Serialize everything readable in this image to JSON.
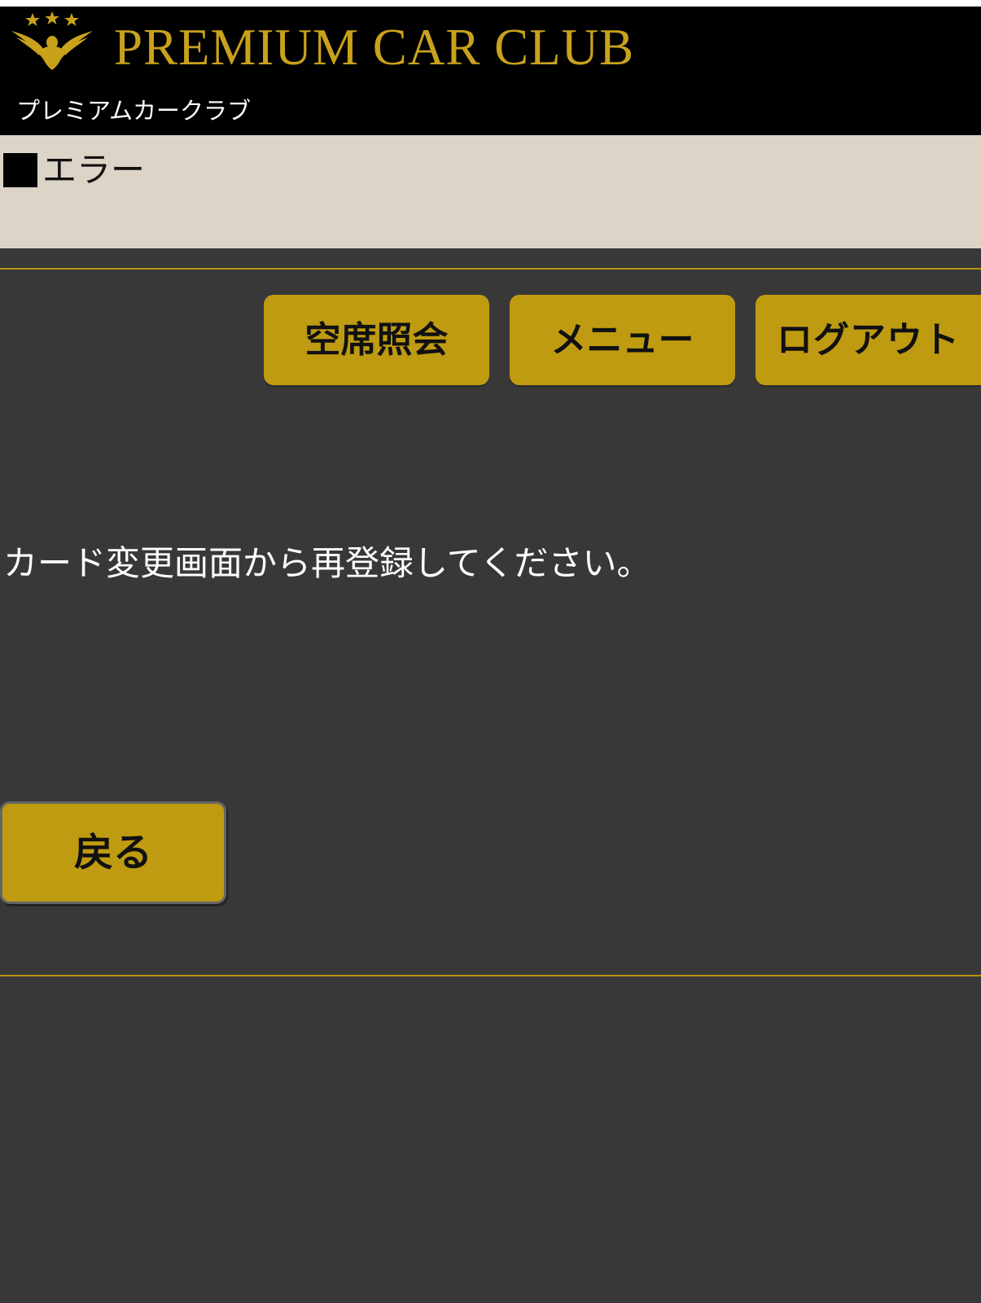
{
  "header": {
    "brand_title": "PREMIUM CAR CLUB",
    "brand_subtitle": "プレミアムカークラブ",
    "logo_icon": "eagle-with-three-stars-emblem",
    "brand_color": "#c9a21b"
  },
  "section": {
    "heading": "エラー"
  },
  "nav": {
    "availability_label": "空席照会",
    "menu_label": "メニュー",
    "logout_label": "ログアウト"
  },
  "main": {
    "message": "カード変更画面から再登録してください。"
  },
  "actions": {
    "back_label": "戻る"
  },
  "colors": {
    "background": "#383838",
    "button": "#bf9b11",
    "heading_bar": "#ddd4c8",
    "rule": "#b8960e"
  }
}
